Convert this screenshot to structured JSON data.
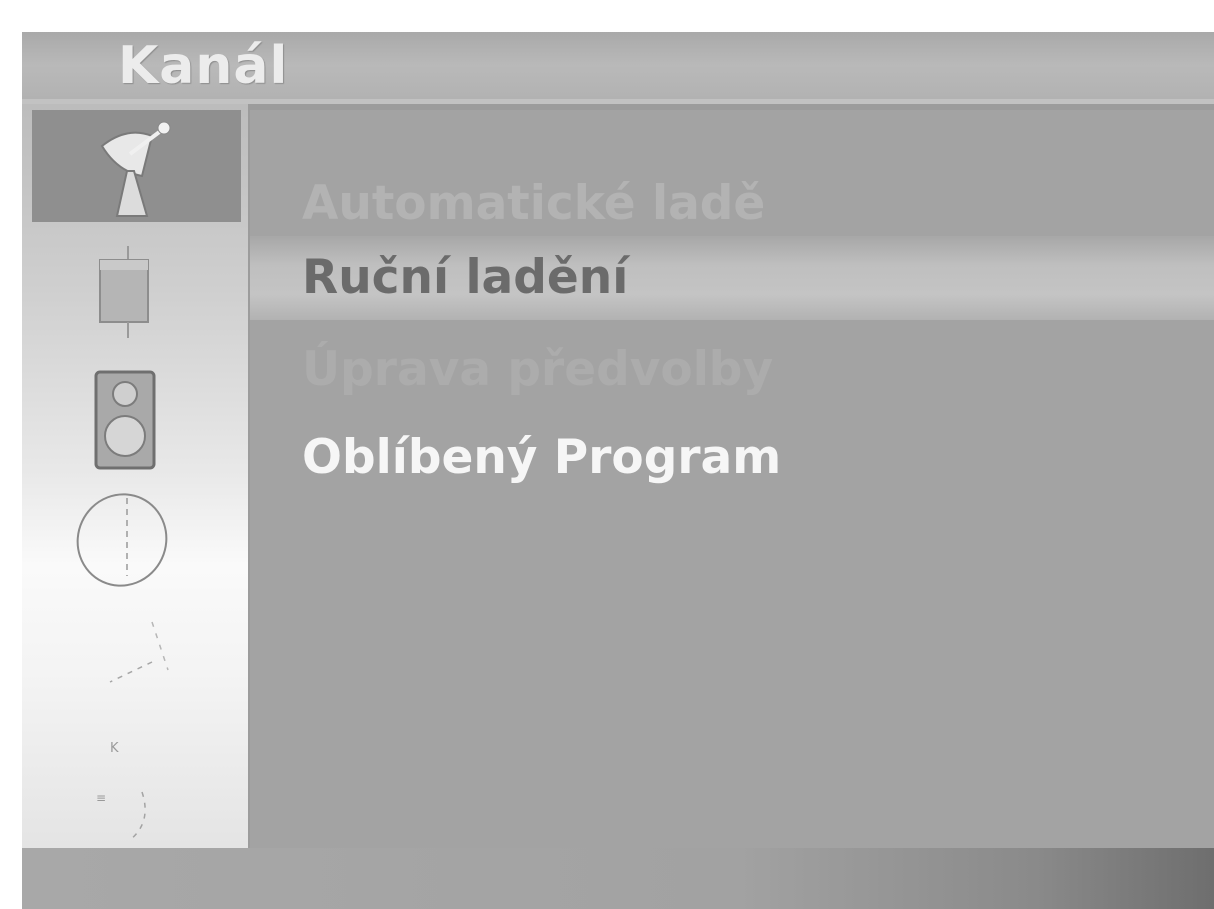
{
  "header": {
    "title": "Kanál"
  },
  "sidebar": {
    "items": [
      {
        "icon": "satellite-dish-icon",
        "active": true
      },
      {
        "icon": "picture-icon",
        "active": false
      },
      {
        "icon": "audio-speaker-icon",
        "active": false
      },
      {
        "icon": "clock-icon",
        "active": false
      },
      {
        "icon": "setup-icon",
        "active": false
      },
      {
        "icon": "input-icon",
        "active": false
      }
    ]
  },
  "menu": {
    "items": [
      {
        "label": "Automatické ladě",
        "state": "dim"
      },
      {
        "label": "Ruční ladění",
        "state": "selected"
      },
      {
        "label": "Úprava předvolby",
        "state": "dim"
      },
      {
        "label": "Oblíbený Program",
        "state": "normal"
      }
    ]
  },
  "colors": {
    "panel": "#a3a3a3",
    "title_bar": "#b9b9b9",
    "highlight": "#c2c2c2",
    "text_bright": "#f6f6f6"
  }
}
